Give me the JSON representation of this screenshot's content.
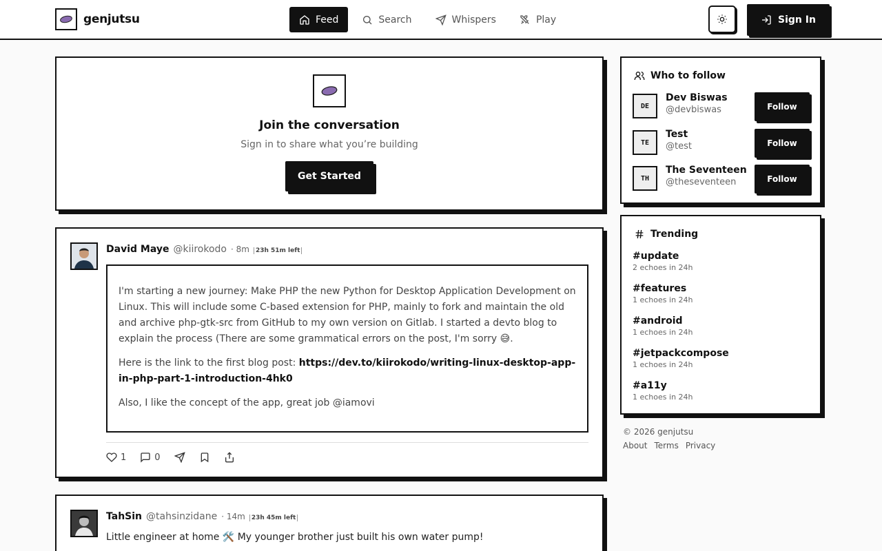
{
  "brand": {
    "name": "genjutsu"
  },
  "nav": [
    {
      "label": "Feed",
      "icon": "home-icon",
      "active": true
    },
    {
      "label": "Search",
      "icon": "search-icon"
    },
    {
      "label": "Whispers",
      "icon": "send-icon"
    },
    {
      "label": "Play",
      "icon": "swords-icon"
    }
  ],
  "header": {
    "signin_label": "Sign In"
  },
  "join": {
    "title": "Join the conversation",
    "subtitle": "Sign in to share what you’re building",
    "cta": "Get Started"
  },
  "posts": [
    {
      "author": "David Maye",
      "handle": "@kiirokodo",
      "time": "· 8m",
      "ttl": "23h 51m left",
      "paragraph1": "I'm starting a new journey: Make PHP the new Python for Desktop Application Development on Linux. This will include some C-based extension for PHP, mainly to fork and maintain the old and archive php-gtk-src from GitHub to my own version on Gitlab. I started a devto blog to explain the process (There are some grammatical errors on the post, I'm sorry 😅.",
      "paragraph2_prefix": "Here is the link to the first blog post: ",
      "link": "https://dev.to/kiirokodo/writing-linux-desktop-app-in-php-part-1-introduction-4hk0",
      "paragraph3": "Also, I like the concept of the app, great job @iamovi",
      "likes": "1",
      "comments": "0"
    },
    {
      "author": "TahSin",
      "handle": "@tahsinzidane",
      "time": "· 14m",
      "ttl": "23h 45m left",
      "text": "Little engineer at home 🛠️ My younger brother just built his own water pump!"
    }
  ],
  "who_to_follow": {
    "title": "Who to follow",
    "follow_label": "Follow",
    "users": [
      {
        "initials": "DE",
        "name": "Dev Biswas",
        "handle": "@devbiswas"
      },
      {
        "initials": "TE",
        "name": "Test",
        "handle": "@test"
      },
      {
        "initials": "TH",
        "name": "The Seventeen",
        "handle": "@theseventeen"
      }
    ]
  },
  "trending": {
    "title": "Trending",
    "tags": [
      {
        "name": "#update",
        "count": "2 echoes in 24h"
      },
      {
        "name": "#features",
        "count": "1 echoes in 24h"
      },
      {
        "name": "#android",
        "count": "1 echoes in 24h"
      },
      {
        "name": "#jetpackcompose",
        "count": "1 echoes in 24h"
      },
      {
        "name": "#a11y",
        "count": "1 echoes in 24h"
      }
    ]
  },
  "footer": {
    "copyright": "© 2026 genjutsu",
    "links": [
      "About",
      "Terms",
      "Privacy"
    ]
  },
  "colors": {
    "ink": "#111111",
    "page_bg": "#fafafa",
    "logo_purple": "#8a6bb0"
  }
}
